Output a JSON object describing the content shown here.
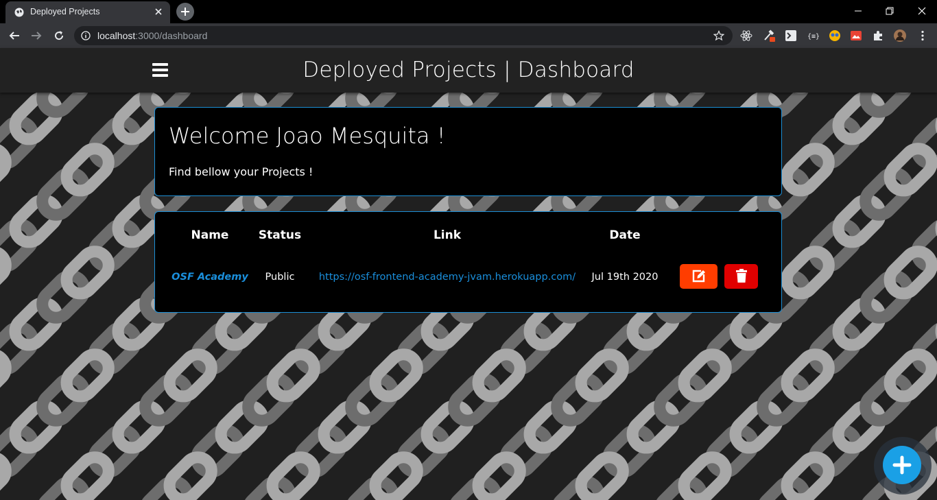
{
  "browser": {
    "tab_title": "Deployed Projects",
    "url_host": "localhost",
    "url_rest": ":3000/dashboard"
  },
  "header": {
    "title": "Deployed Projects | Dashboard"
  },
  "welcome": {
    "title": "Welcome Joao Mesquita !",
    "subtitle": "Find bellow your Projects !"
  },
  "table": {
    "columns": [
      "Name",
      "Status",
      "Link",
      "Date"
    ],
    "rows": [
      {
        "name": "OSF Academy",
        "status": "Public",
        "link": "https://osf-frontend-academy-jvam.herokuapp.com/",
        "date": "Jul 19th 2020"
      }
    ]
  },
  "colors": {
    "accent": "#1a8fdc",
    "edit": "#ff3d00",
    "delete": "#e00000",
    "fab": "#1aa0e6"
  },
  "icons": [
    "menu-icon",
    "edit-icon",
    "trash-icon",
    "plus-icon",
    "link-pattern"
  ]
}
